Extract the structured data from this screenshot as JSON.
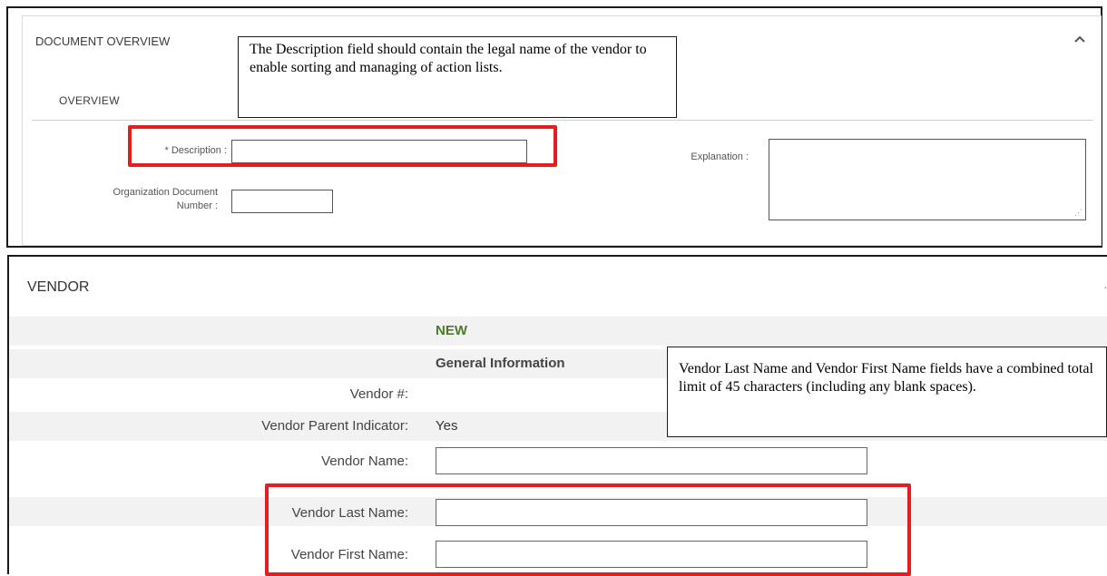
{
  "overview": {
    "section_title": "DOCUMENT OVERVIEW",
    "tab_label": "OVERVIEW",
    "collapse_icon": "chevron-up-icon",
    "description_label": "* Description :",
    "description_value": "",
    "org_doc_label_line1": "Organization Document",
    "org_doc_label_line2": "Number :",
    "org_doc_value": "",
    "explanation_label": "Explanation :",
    "explanation_value": ""
  },
  "callouts": {
    "description_note": "The Description field should contain the legal name of the vendor to enable sorting and managing of action lists.",
    "vendor_name_note": "Vendor Last Name and Vendor First Name fields have a combined total limit of 45 characters (including any blank spaces)."
  },
  "vendor": {
    "section_title": "VENDOR",
    "column_header": "NEW",
    "group_header": "General Information",
    "vendor_number_label": "Vendor #:",
    "vendor_number_value": "",
    "parent_indicator_label": "Vendor Parent Indicator:",
    "parent_indicator_value": "Yes",
    "vendor_name_label": "Vendor Name:",
    "vendor_name_value": "",
    "last_name_label": "Vendor Last Name:",
    "last_name_value": "",
    "first_name_label": "Vendor First Name:",
    "first_name_value": ""
  },
  "colors": {
    "highlight_red": "#e41e1e",
    "new_green": "#4a7c2a"
  }
}
